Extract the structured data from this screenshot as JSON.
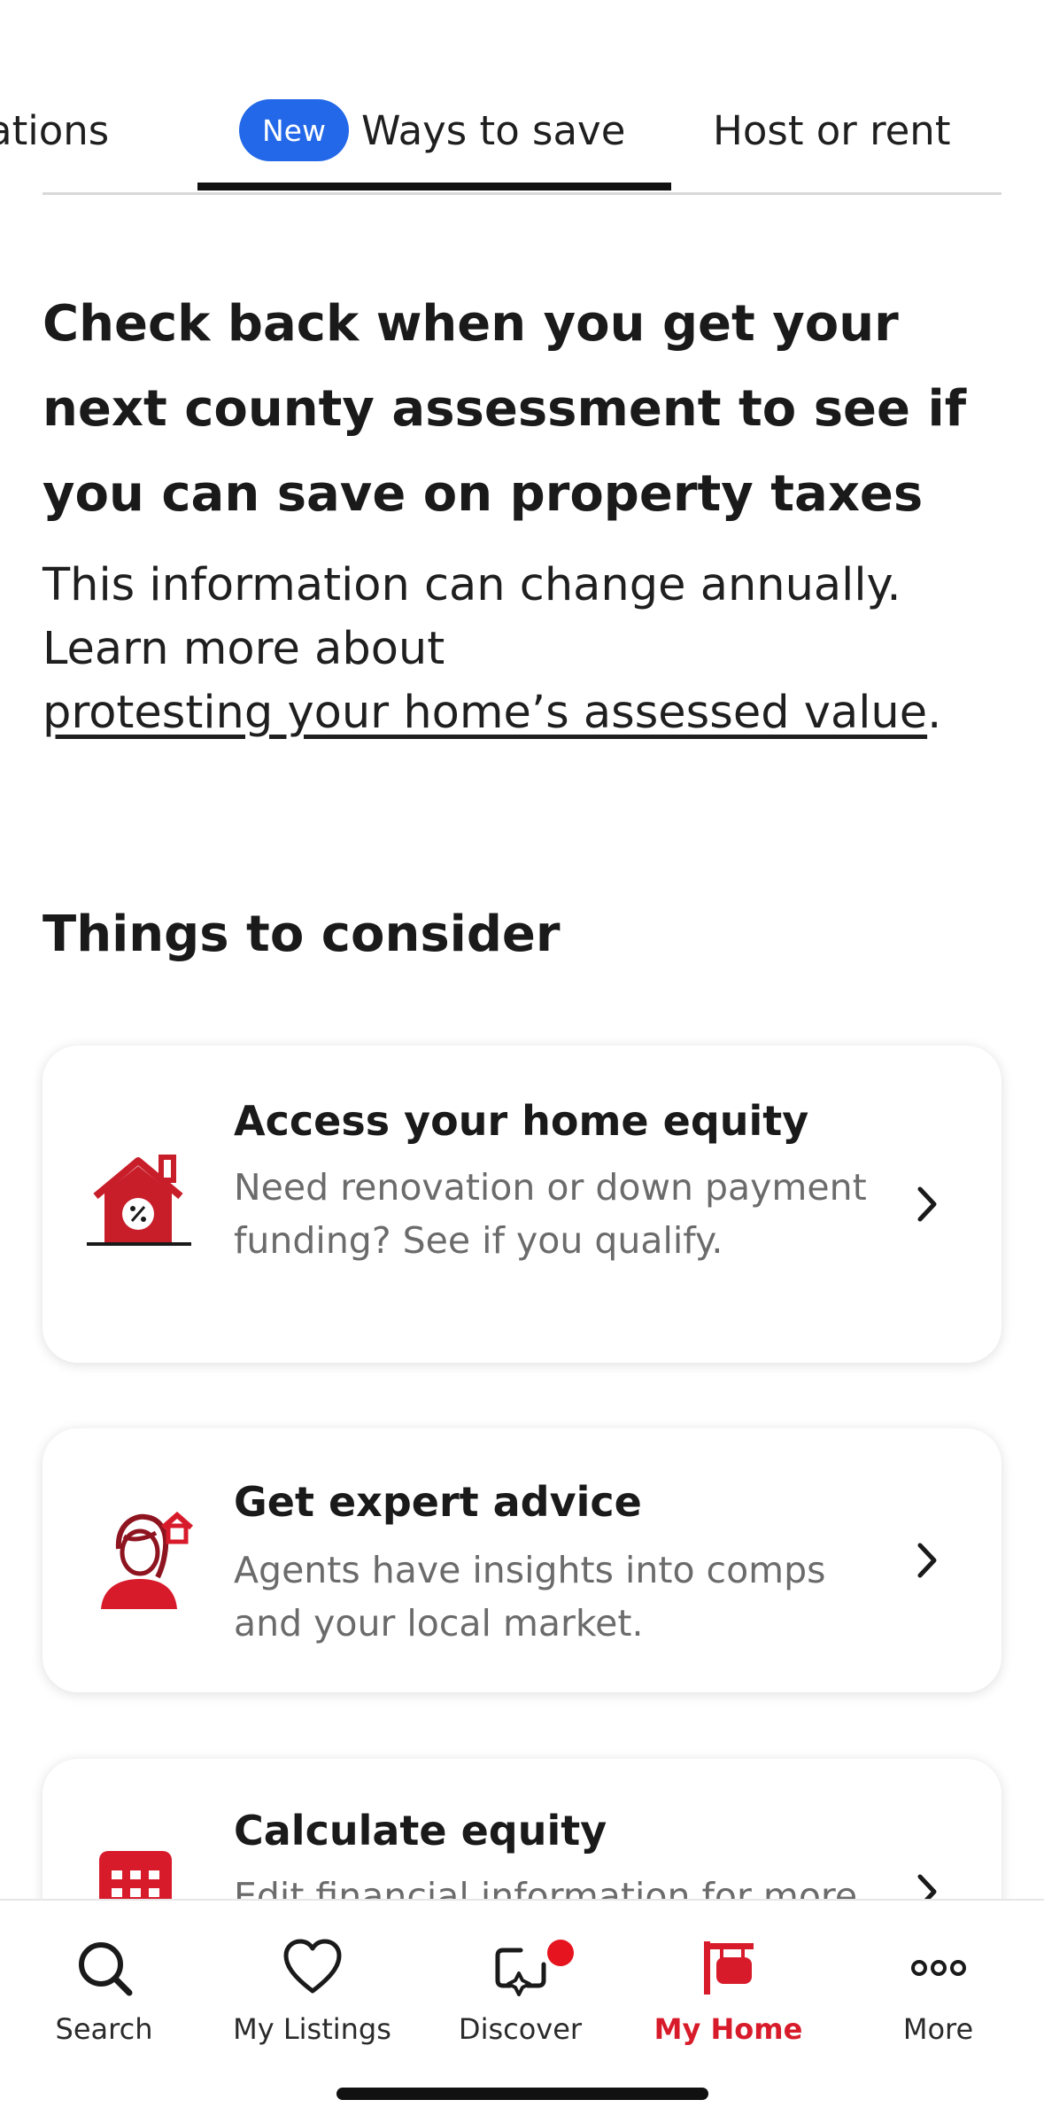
{
  "tabs": {
    "partial_label": "ations",
    "active": {
      "badge": "New",
      "label": "Ways to save"
    },
    "host_label": "Host or rent"
  },
  "hero": {
    "title": "Check back when you get your next county assessment to see if you can save on property taxes",
    "body_line1": "This information can change annually.",
    "body_line2": "Learn more about",
    "link_text": "protesting your home’s assessed value",
    "link_suffix": "."
  },
  "section": {
    "title": "Things to consider"
  },
  "cards": [
    {
      "title": "Access your home equity",
      "description": "Need renovation or down payment funding? See if you qualify.",
      "icon": "house-percent-icon"
    },
    {
      "title": "Get expert advice",
      "description": "Agents have insights into comps and your local market.",
      "icon": "agent-icon"
    },
    {
      "title": "Calculate equity",
      "description": "Edit financial information for more",
      "icon": "calculator-icon"
    }
  ],
  "nav": {
    "search": "Search",
    "listings": "My Listings",
    "discover": "Discover",
    "home": "My Home",
    "more": "More"
  },
  "colors": {
    "accent_red": "#d81b2b",
    "badge_blue": "#2268e8",
    "icon_red": "#c81e2a"
  }
}
